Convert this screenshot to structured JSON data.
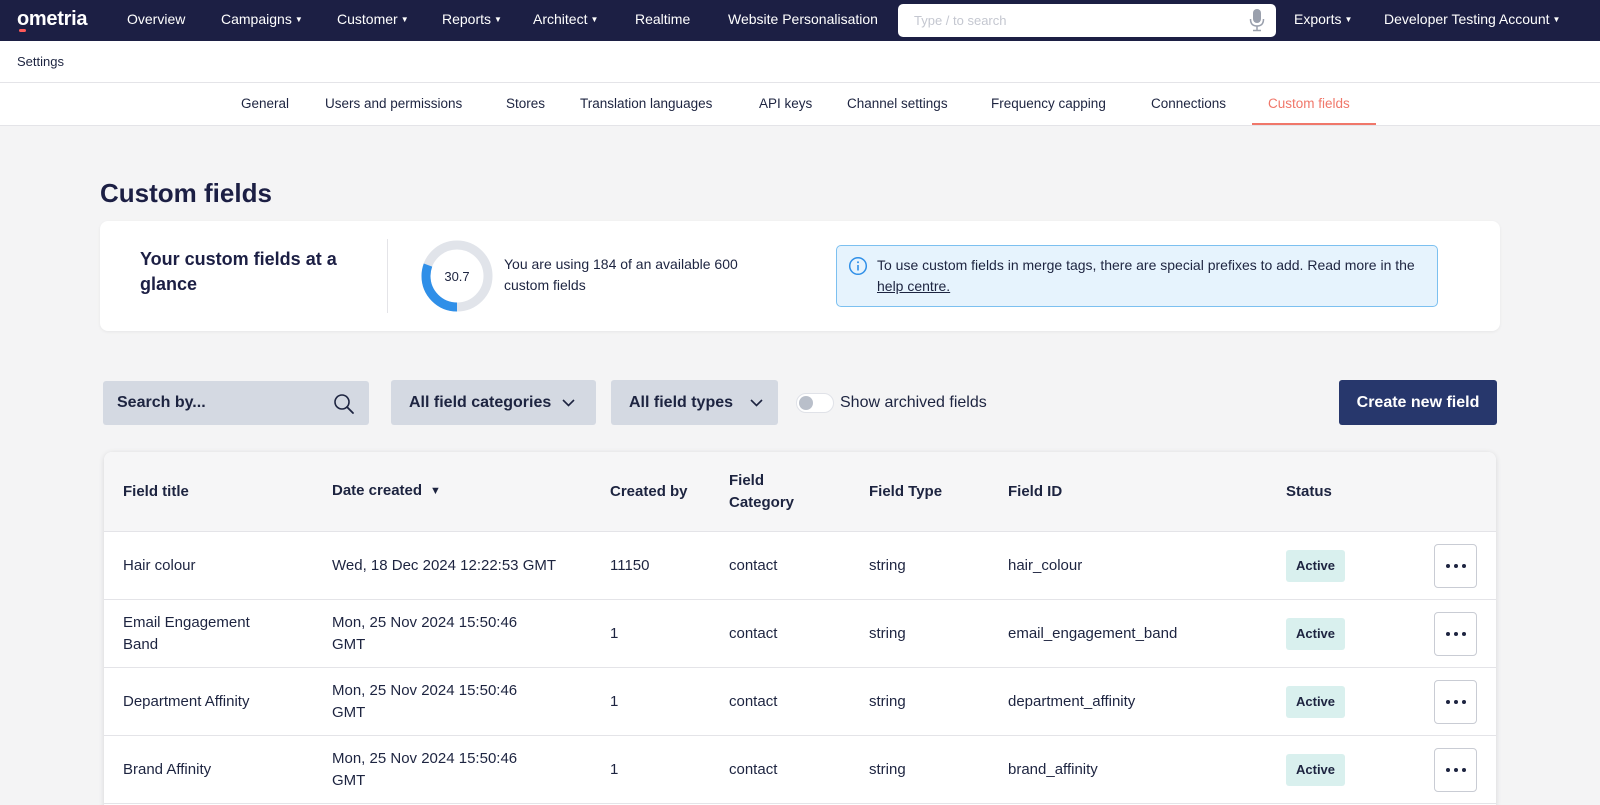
{
  "nav": {
    "logo": "ometria",
    "items": [
      "Overview",
      "Campaigns",
      "Customer",
      "Reports",
      "Architect",
      "Realtime",
      "Website Personalisation"
    ],
    "search_placeholder": "Type / to search",
    "exports": "Exports",
    "account": "Developer Testing Account",
    "icons": [
      "microphone-icon"
    ]
  },
  "breadcrumb": "Settings",
  "tabs": [
    "General",
    "Users and permissions",
    "Stores",
    "Translation languages",
    "API keys",
    "Channel settings",
    "Frequency capping",
    "Connections",
    "Custom fields"
  ],
  "active_tab": "Custom fields",
  "page_title": "Custom fields",
  "glance": {
    "title": "Your custom fields at a glance",
    "donut_value": "30.7",
    "donut_fraction": 0.307,
    "usage_text": "You are using 184 of an available 600 custom fields",
    "info_text": "To use custom fields in merge tags, there are special prefixes to add. Read more in the",
    "info_link": "help centre."
  },
  "toolbar": {
    "search_placeholder": "Search by...",
    "categories_dropdown": "All field categories",
    "types_dropdown": "All field types",
    "archived_toggle": "Show archived fields",
    "archived_on": false,
    "create_button": "Create new field"
  },
  "table": {
    "headers": {
      "title": "Field title",
      "date": "Date created",
      "created_by": "Created by",
      "category_1": "Field",
      "category_2": "Category",
      "type": "Field Type",
      "id": "Field ID",
      "status": "Status"
    },
    "sort_indicator": "▼",
    "rows": [
      {
        "title_1": "Hair colour",
        "title_2": "",
        "date_1": "Wed, 18 Dec 2024 12:22:53 GMT",
        "date_2": "",
        "created_by": "11150",
        "category": "contact",
        "type": "string",
        "id": "hair_colour",
        "status": "Active"
      },
      {
        "title_1": "Email Engagement",
        "title_2": "Band",
        "date_1": "Mon, 25 Nov 2024 15:50:46",
        "date_2": "GMT",
        "created_by": "1",
        "category": "contact",
        "type": "string",
        "id": "email_engagement_band",
        "status": "Active"
      },
      {
        "title_1": "Department Affinity",
        "title_2": "",
        "date_1": "Mon, 25 Nov 2024 15:50:46",
        "date_2": "GMT",
        "created_by": "1",
        "category": "contact",
        "type": "string",
        "id": "department_affinity",
        "status": "Active"
      },
      {
        "title_1": "Brand Affinity",
        "title_2": "",
        "date_1": "Mon, 25 Nov 2024 15:50:46",
        "date_2": "GMT",
        "created_by": "1",
        "category": "contact",
        "type": "string",
        "id": "brand_affinity",
        "status": "Active"
      }
    ]
  },
  "colors": {
    "nav_bg": "#1c1f44",
    "accent": "#f0776a",
    "primary_button": "#27376c",
    "donut_fill": "#2f8fe8",
    "badge_bg": "#d9f0ee"
  }
}
